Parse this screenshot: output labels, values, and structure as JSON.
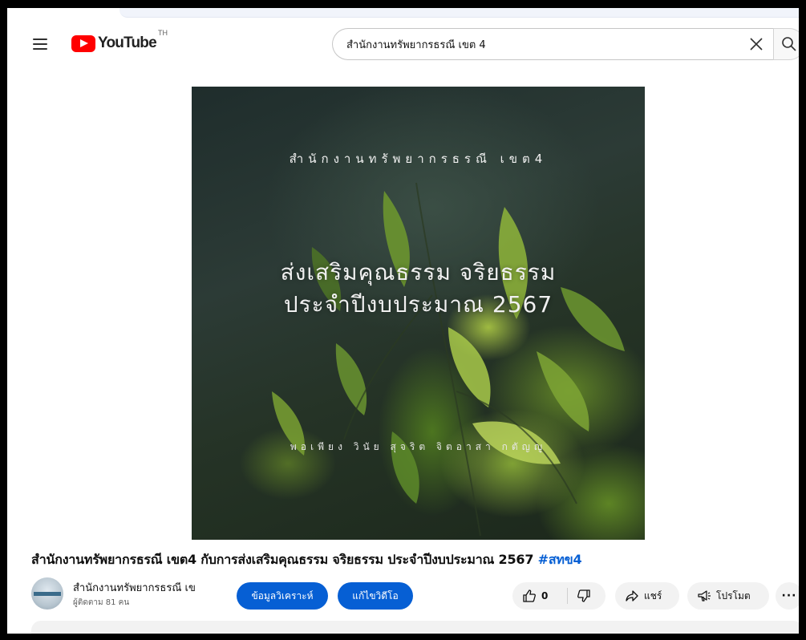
{
  "header": {
    "logo_text": "YouTube",
    "region": "TH",
    "search_value": "สำนักงานทรัพยากรธรณี เขต 4"
  },
  "thumbnail": {
    "org": "สำนักงานทรัพยากรธรณี เขต4",
    "headline_1": "ส่งเสริมคุณธรรม จริยธรรม",
    "headline_2": "ประจำปีงบประมาณ 2567",
    "values": "พอเพียง วินัย สุจริต จิตอาสา กตัญญู"
  },
  "video": {
    "title": "สำนักงานทรัพยากรธรณี เขต4 กับการส่งเสริมคุณธรรม จริยธรรม ประจำปีงบประมาณ 2567",
    "hashtag": "#สทข4"
  },
  "channel": {
    "name": "สำนักงานทรัพยากรธรณี เข",
    "subscribers": "ผู้ติดตาม 81 คน"
  },
  "actions": {
    "analytics": "ข้อมูลวิเคราะห์",
    "edit_video": "แก้ไขวิดีโอ",
    "like_count": "0",
    "share": "แชร์",
    "promote": "โปรโมต",
    "more": "···"
  },
  "icons": [
    "menu-icon",
    "youtube-logo-icon",
    "clear-icon",
    "search-icon",
    "like-icon",
    "dislike-icon",
    "share-icon",
    "promote-icon",
    "more-icon"
  ],
  "colors": {
    "brand_red": "#ff0000",
    "action_blue": "#065fd4",
    "pill_gray": "#f2f2f2"
  }
}
